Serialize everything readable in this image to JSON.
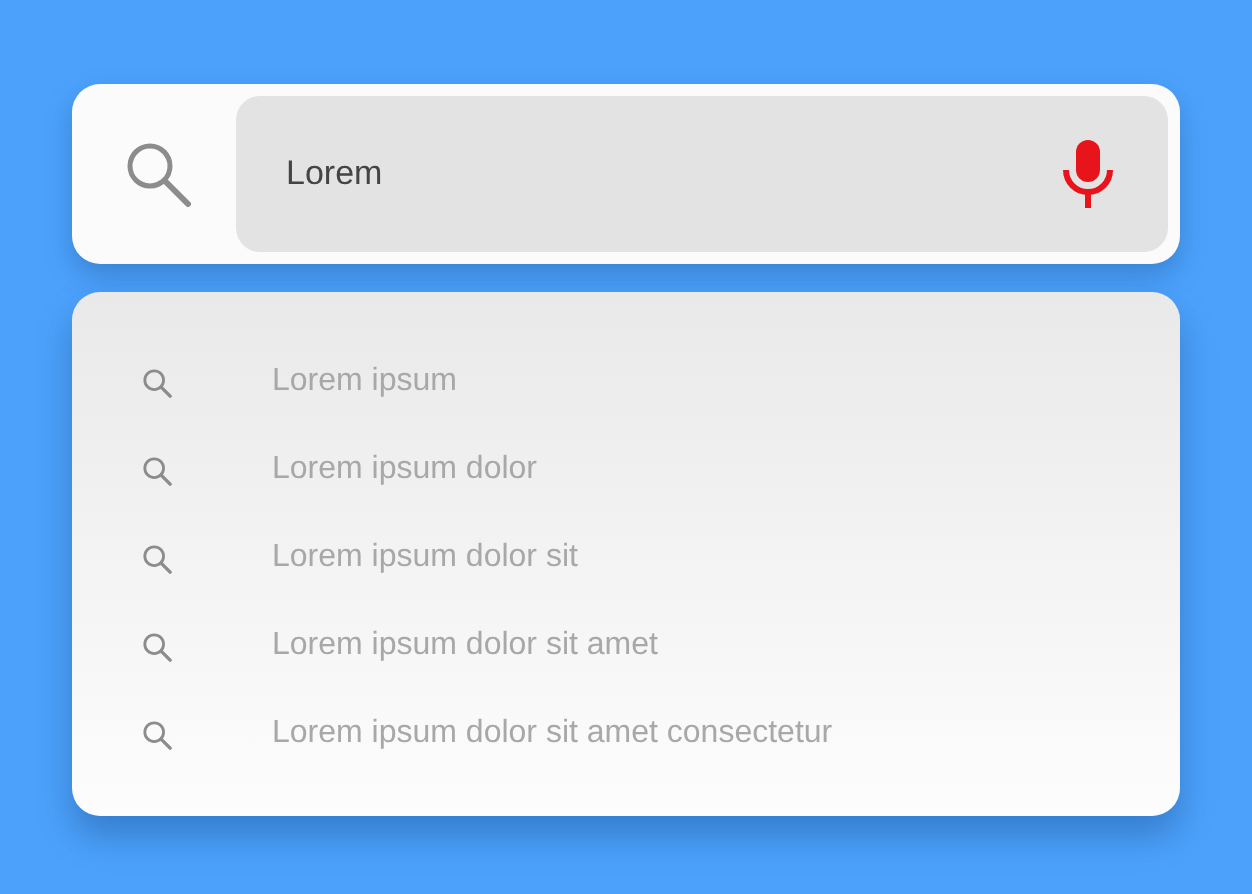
{
  "search": {
    "value": "Lorem"
  },
  "suggestions": [
    {
      "text": "Lorem ipsum"
    },
    {
      "text": "Lorem ipsum dolor"
    },
    {
      "text": "Lorem ipsum dolor sit"
    },
    {
      "text": "Lorem ipsum dolor sit amet"
    },
    {
      "text": "Lorem ipsum dolor sit amet consectetur"
    }
  ]
}
